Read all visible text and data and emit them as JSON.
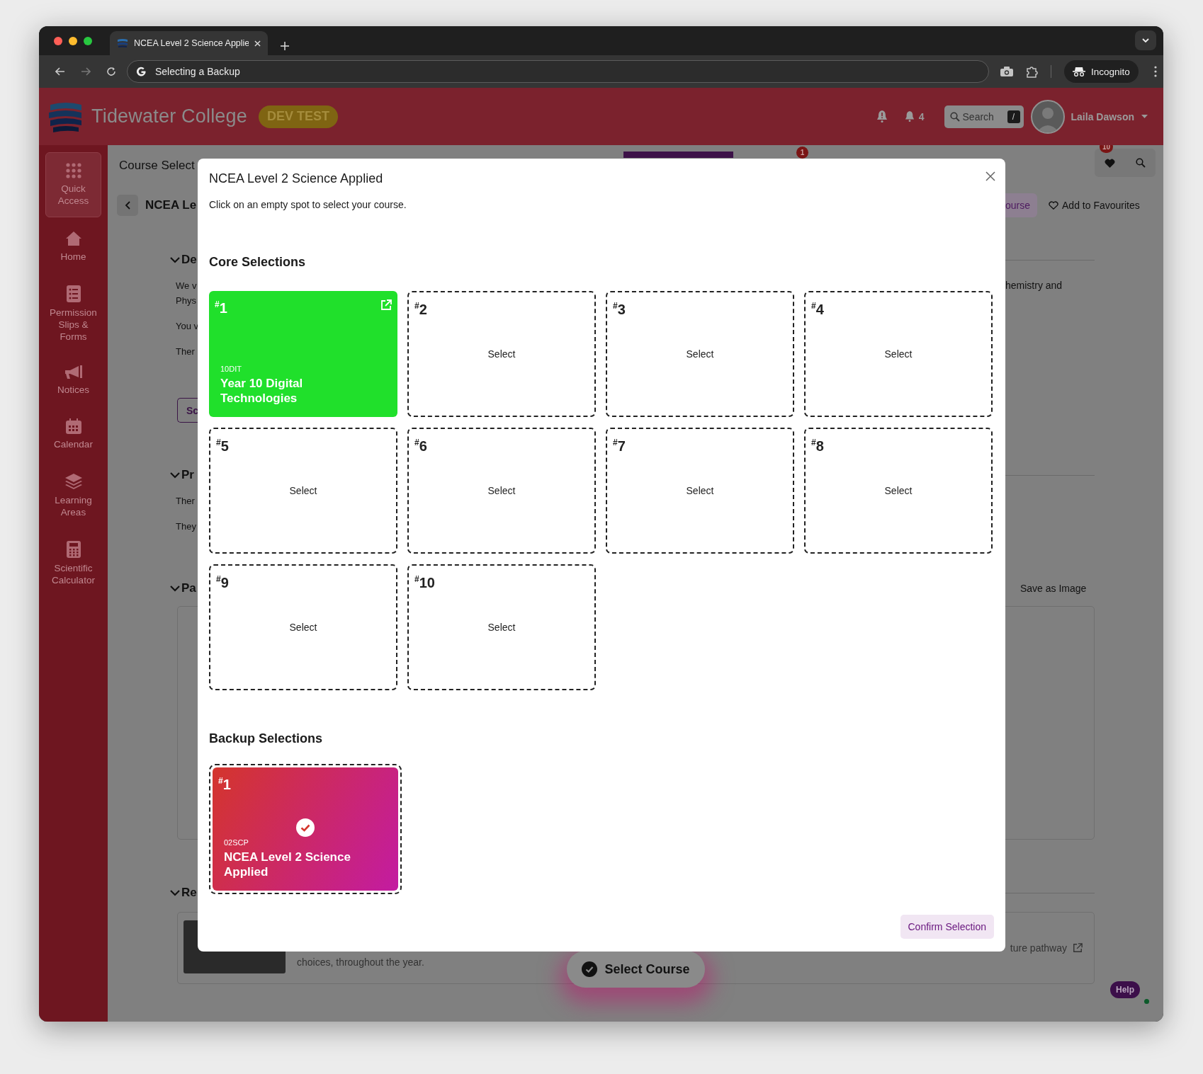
{
  "browser": {
    "tab_title": "NCEA Level 2 Science Applie",
    "url": "Selecting a Backup",
    "profile": "Incognito"
  },
  "header": {
    "school": "Tidewater College",
    "badge": "DEV TEST",
    "notification_count": "4",
    "search": {
      "placeholder": "Search",
      "shortcut": "/"
    },
    "user": "Laila Dawson"
  },
  "sidebar": {
    "items": [
      {
        "label": "Quick Access",
        "kind": "grid",
        "selected": true
      },
      {
        "label": "Home",
        "kind": "home",
        "selected": false
      },
      {
        "label": "Permission Slips & Forms",
        "kind": "list",
        "selected": false
      },
      {
        "label": "Notices",
        "kind": "megaphone",
        "selected": false
      },
      {
        "label": "Calendar",
        "kind": "calendar",
        "selected": false
      },
      {
        "label": "Learning Areas",
        "kind": "layers",
        "selected": false
      },
      {
        "label": "Scientific Calculator",
        "kind": "calculator",
        "selected": false
      }
    ]
  },
  "page": {
    "title": "Course Select",
    "tab_badge": "1",
    "favourites_count": "10",
    "course_title": "NCEA Le",
    "primary_button": "ourse",
    "favourite_button": "Add to Favourites",
    "sections": [
      {
        "heading": "De",
        "paragraphs": [
          [
            {
              "left": "We v",
              "right": "hemistry and"
            },
            {
              "left": "Phys"
            }
          ],
          [
            {
              "left": "You v"
            }
          ],
          [
            {
              "left": "Ther"
            }
          ]
        ],
        "button": "Sc"
      },
      {
        "heading": "Pr",
        "paragraphs": [
          [
            {
              "left": "Ther"
            }
          ],
          [
            {
              "left": "They"
            }
          ]
        ]
      },
      {
        "heading": "Pa",
        "action": "Save as Image",
        "kind": "box"
      },
      {
        "heading": "Re",
        "kind": "resource",
        "resource_text": "choices, throughout the year.",
        "resource_link": "ture pathway"
      }
    ],
    "select_course": "Select Course",
    "help": "Help"
  },
  "modal": {
    "title": "NCEA Level 2 Science Applied",
    "instructions": "Click on an empty spot to select your course.",
    "core": {
      "heading": "Core Selections",
      "slots": [
        {
          "number": "$^{#}$1",
          "kind": "filled",
          "code": "10DIT",
          "name": "Year 10 Digital Technologies",
          "color": "#20e02b"
        },
        {
          "number": "$^{#}$2",
          "kind": "empty",
          "action": "Select"
        },
        {
          "number": "$^{#}$3",
          "kind": "empty",
          "action": "Select"
        },
        {
          "number": "$^{#}$4",
          "kind": "empty",
          "action": "Select"
        },
        {
          "number": "$^{#}$5",
          "kind": "empty",
          "action": "Select"
        },
        {
          "number": "$^{#}$6",
          "kind": "empty",
          "action": "Select"
        },
        {
          "number": "$^{#}$7",
          "kind": "empty",
          "action": "Select"
        },
        {
          "number": "$^{#}$8",
          "kind": "empty",
          "action": "Select"
        },
        {
          "number": "$^{#}$9",
          "kind": "empty",
          "action": "Select"
        },
        {
          "number": "$^{#}$10",
          "kind": "empty",
          "action": "Select"
        }
      ]
    },
    "backup": {
      "heading": "Backup Selections",
      "slots": [
        {
          "number": "$^{#}$1",
          "kind": "filled",
          "code": "02SCP",
          "name": "NCEA Level 2 Science Applied",
          "color": "#d4352c",
          "selected": true
        }
      ]
    },
    "confirm": "Confirm Selection"
  }
}
